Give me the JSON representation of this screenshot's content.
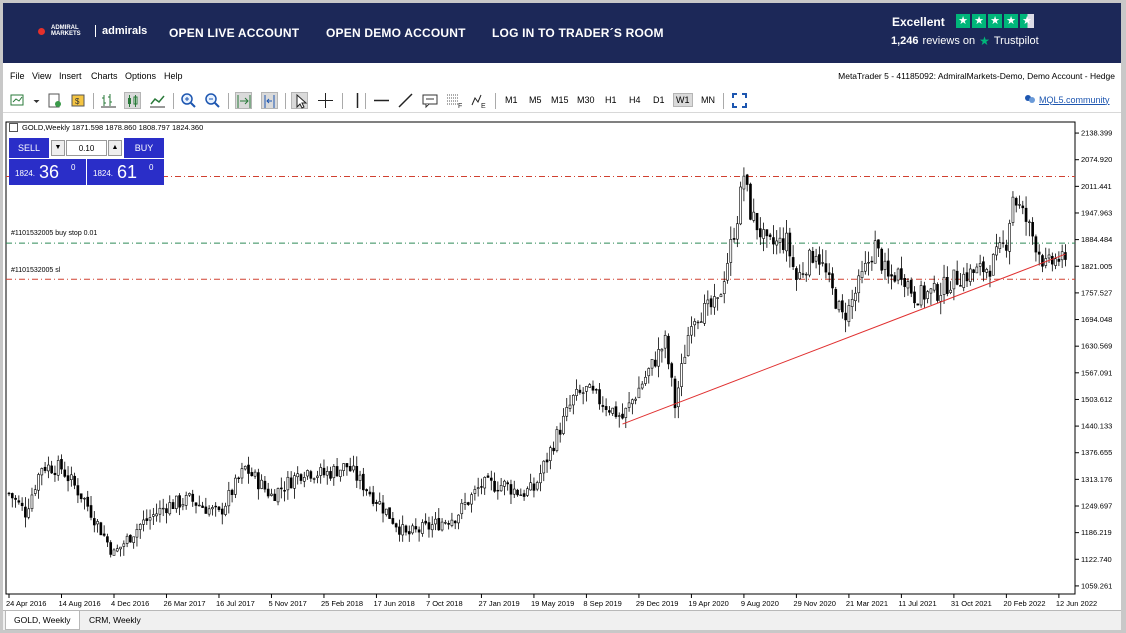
{
  "header": {
    "logo_small": "ADMIRAL MARKETS",
    "logo_name": "admirals",
    "nav": [
      "OPEN LIVE ACCOUNT",
      "OPEN DEMO ACCOUNT",
      "LOG IN TO TRADER´S ROOM"
    ],
    "trustpilot": {
      "rating_text": "Excellent",
      "reviews": "1,246",
      "reviews_on": "reviews on",
      "brand": "Trustpilot",
      "stars_green": "#00b67a"
    }
  },
  "menu": {
    "items": [
      "File",
      "View",
      "Insert",
      "Charts",
      "Options",
      "Help"
    ],
    "title": "MetaTrader 5 - 41185092: AdmiralMarkets-Demo, Demo Account - Hedge"
  },
  "toolbar": {
    "timeframes": [
      "M1",
      "M5",
      "M15",
      "M30",
      "H1",
      "H4",
      "D1",
      "W1",
      "MN"
    ],
    "active_timeframe": "W1",
    "community_link": "MQL5.community"
  },
  "chart": {
    "symbol_info": "GOLD,Weekly  1871.598 1878.860 1808.797 1824.360",
    "trade": {
      "sell_label": "SELL",
      "buy_label": "BUY",
      "volume": "0.10",
      "sell_price_small": "1824.",
      "sell_price_big": "36",
      "sell_price_sup": "0",
      "buy_price_small": "1824.",
      "buy_price_big": "61",
      "buy_price_sup": "0",
      "button_color": "#2a2ec8"
    },
    "order_labels": {
      "buy_stop": "#1101532005 buy stop 0.01",
      "sl": "#1101532005 sl"
    }
  },
  "chart_data": {
    "type": "candlestick",
    "symbol": "GOLD",
    "timeframe": "Weekly",
    "ylim": [
      1040,
      2160
    ],
    "y_ticks": [
      "2138.399",
      "2074.920",
      "2011.441",
      "1947.963",
      "1884.484",
      "1821.005",
      "1757.527",
      "1694.048",
      "1630.569",
      "1567.091",
      "1503.612",
      "1440.133",
      "1376.655",
      "1313.176",
      "1249.697",
      "1186.219",
      "1122.740",
      "1059.261"
    ],
    "x_ticks": [
      "24 Apr 2016",
      "14 Aug 2016",
      "4 Dec 2016",
      "26 Mar 2017",
      "16 Jul 2017",
      "5 Nov 2017",
      "25 Feb 2018",
      "17 Jun 2018",
      "7 Oct 2018",
      "27 Jan 2019",
      "19 May 2019",
      "8 Sep 2019",
      "29 Dec 2019",
      "19 Apr 2020",
      "9 Aug 2020",
      "29 Nov 2020",
      "21 Mar 2021",
      "11 Jul 2021",
      "31 Oct 2021",
      "20 Feb 2022",
      "12 Jun 2022"
    ],
    "hlines": [
      {
        "name": "sl-upper",
        "value": 2035,
        "color": "#d04030"
      },
      {
        "name": "buy-stop",
        "value": 1876,
        "color": "#2e8b57"
      },
      {
        "name": "sl",
        "value": 1790,
        "color": "#d04030"
      }
    ],
    "trendline": {
      "from": {
        "date": "2019-11-24",
        "price": 1445
      },
      "to": {
        "date": "2022-06-26",
        "price": 1850
      },
      "color": "#e03030"
    },
    "grid": false,
    "candle_color": "#000000",
    "price_path": [
      [
        "2016-04-24",
        1280
      ],
      [
        "2016-05-29",
        1235
      ],
      [
        "2016-07-03",
        1345
      ],
      [
        "2016-08-14",
        1340
      ],
      [
        "2016-10-02",
        1265
      ],
      [
        "2016-12-04",
        1135
      ],
      [
        "2017-01-29",
        1205
      ],
      [
        "2017-03-26",
        1250
      ],
      [
        "2017-05-14",
        1265
      ],
      [
        "2017-07-16",
        1230
      ],
      [
        "2017-09-10",
        1340
      ],
      [
        "2017-11-05",
        1275
      ],
      [
        "2018-01-14",
        1335
      ],
      [
        "2018-02-25",
        1325
      ],
      [
        "2018-04-15",
        1345
      ],
      [
        "2018-06-17",
        1265
      ],
      [
        "2018-08-19",
        1180
      ],
      [
        "2018-10-07",
        1200
      ],
      [
        "2018-12-02",
        1225
      ],
      [
        "2019-01-27",
        1300
      ],
      [
        "2019-03-17",
        1300
      ],
      [
        "2019-04-21",
        1280
      ],
      [
        "2019-05-19",
        1290
      ],
      [
        "2019-06-30",
        1400
      ],
      [
        "2019-08-11",
        1505
      ],
      [
        "2019-09-08",
        1525
      ],
      [
        "2019-10-20",
        1490
      ],
      [
        "2019-11-24",
        1460
      ],
      [
        "2019-12-29",
        1530
      ],
      [
        "2020-02-23",
        1640
      ],
      [
        "2020-03-15",
        1490
      ],
      [
        "2020-04-19",
        1700
      ],
      [
        "2020-06-14",
        1730
      ],
      [
        "2020-07-26",
        1940
      ],
      [
        "2020-08-09",
        2040
      ],
      [
        "2020-08-23",
        1950
      ],
      [
        "2020-09-27",
        1870
      ],
      [
        "2020-11-08",
        1880
      ],
      [
        "2020-11-29",
        1790
      ],
      [
        "2021-01-10",
        1860
      ],
      [
        "2021-03-07",
        1700
      ],
      [
        "2021-03-21",
        1720
      ],
      [
        "2021-05-16",
        1870
      ],
      [
        "2021-06-13",
        1790
      ],
      [
        "2021-07-11",
        1810
      ],
      [
        "2021-08-08",
        1750
      ],
      [
        "2021-09-26",
        1760
      ],
      [
        "2021-10-31",
        1790
      ],
      [
        "2022-01-16",
        1820
      ],
      [
        "2022-02-20",
        1880
      ],
      [
        "2022-03-06",
        1990
      ],
      [
        "2022-04-03",
        1930
      ],
      [
        "2022-05-15",
        1820
      ],
      [
        "2022-06-12",
        1840
      ],
      [
        "2022-06-26",
        1824
      ]
    ]
  },
  "tabs": [
    "GOLD, Weekly",
    "CRM, Weekly"
  ]
}
